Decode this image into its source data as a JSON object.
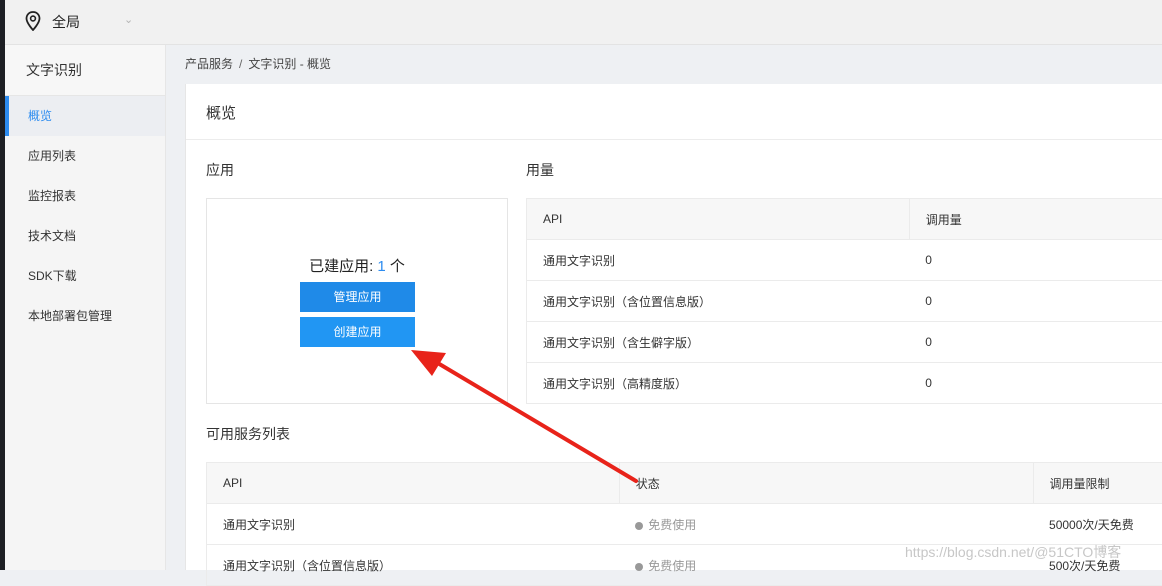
{
  "topbar": {
    "region": "全局"
  },
  "sidebar": {
    "title": "文字识别",
    "items": [
      {
        "label": "概览",
        "active": true
      },
      {
        "label": "应用列表"
      },
      {
        "label": "监控报表"
      },
      {
        "label": "技术文档"
      },
      {
        "label": "SDK下载"
      },
      {
        "label": "本地部署包管理"
      }
    ]
  },
  "breadcrumb": {
    "parent": "产品服务",
    "separator": "/",
    "current": "文字识别 - 概览"
  },
  "page_title": "概览",
  "apps": {
    "section_title": "应用",
    "count_prefix": "已建应用: ",
    "count": "1",
    "count_suffix": " 个",
    "manage_button": "管理应用",
    "create_button": "创建应用"
  },
  "usage": {
    "section_title": "用量",
    "headers": [
      "API",
      "调用量"
    ],
    "rows": [
      [
        "通用文字识别",
        "0"
      ],
      [
        "通用文字识别（含位置信息版）",
        "0"
      ],
      [
        "通用文字识别（含生僻字版）",
        "0"
      ],
      [
        "通用文字识别（高精度版）",
        "0"
      ]
    ]
  },
  "services": {
    "section_title": "可用服务列表",
    "headers": [
      "API",
      "状态",
      "调用量限制"
    ],
    "rows": [
      [
        "通用文字识别",
        "免费使用",
        "50000次/天免费"
      ],
      [
        "通用文字识别（含位置信息版）",
        "免费使用",
        "500次/天免费"
      ]
    ]
  },
  "watermark": "https://blog.csdn.net/@51CTO博客",
  "colors": {
    "accent": "#2d8cf0",
    "button": "#2196f3",
    "arrow": "#e8231a"
  }
}
